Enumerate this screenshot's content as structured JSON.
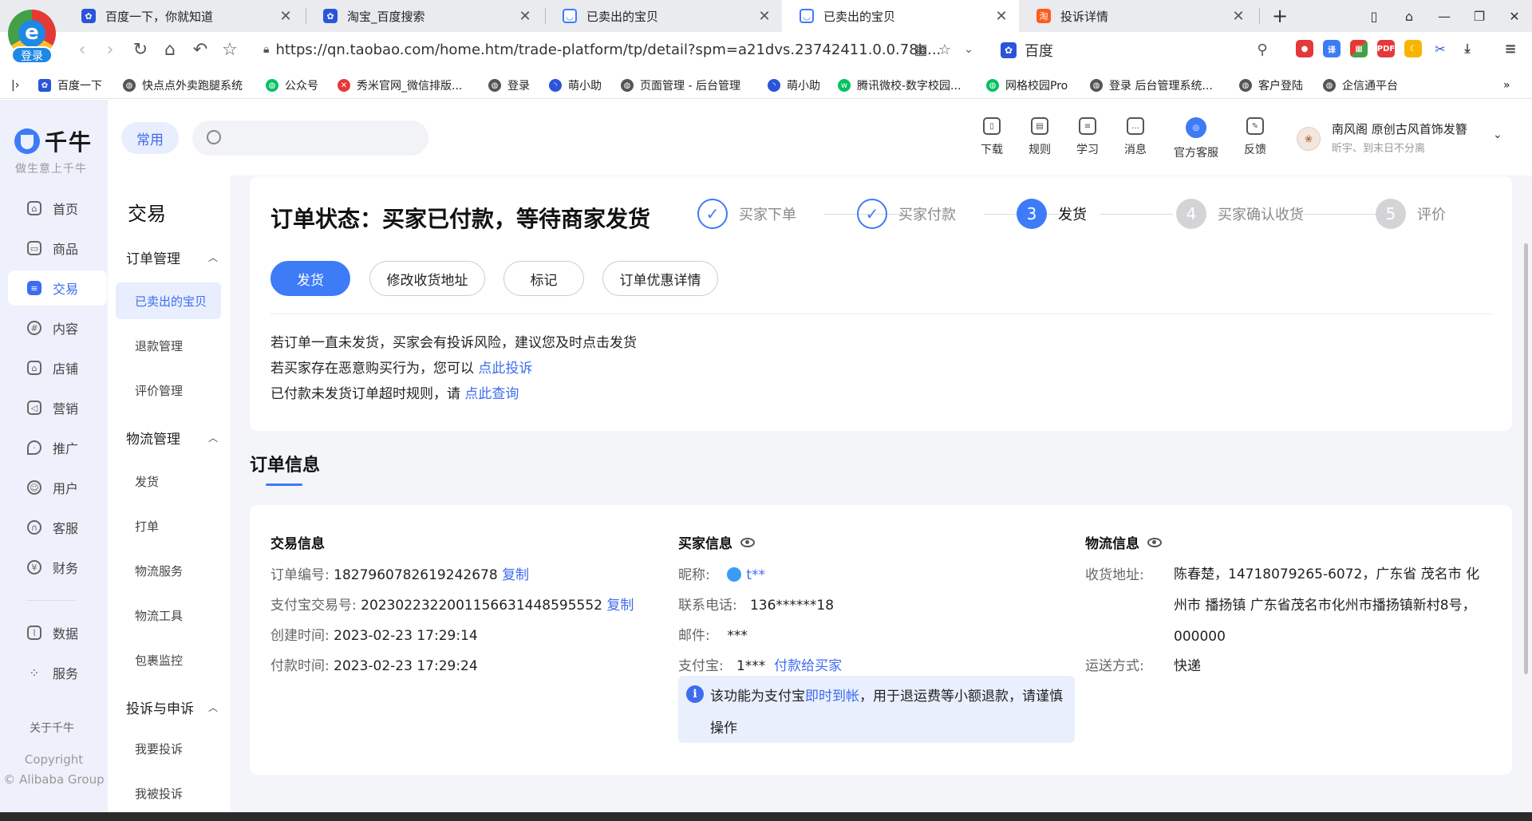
{
  "browser": {
    "logo_letter": "e",
    "logo_login": "登录",
    "tabs": [
      {
        "title": "百度一下，你就知道",
        "favicon": "baidu-icon",
        "active": false
      },
      {
        "title": "淘宝_百度搜索",
        "favicon": "baidu-icon",
        "active": false
      },
      {
        "title": "已卖出的宝贝",
        "favicon": "qianniu-icon",
        "active": false
      },
      {
        "title": "已卖出的宝贝",
        "favicon": "qianniu-icon",
        "active": true
      },
      {
        "title": "投诉详情",
        "favicon": "taobao-icon",
        "active": false
      }
    ],
    "new_tab": "+",
    "url": "https://qn.taobao.com/home.htm/trade-platform/tp/detail?spm=a21dvs.23742411.0.0.78b...",
    "search_engine": "百度",
    "bookmarks": [
      "百度一下",
      "快点点外卖跑腿系统",
      "公众号",
      "秀米官网_微信排版...",
      "登录",
      "萌小助",
      "页面管理 - 后台管理",
      "萌小助",
      "腾讯微校-数字校园...",
      "网格校园Pro",
      "登录 后台管理系统...",
      "客户登陆",
      "企信通平台"
    ],
    "more": "»",
    "colors": {
      "accent": "#3d7bf7"
    }
  },
  "app": {
    "brand_name": "千牛",
    "brand_slogan": "做生意上千牛",
    "nav": [
      {
        "label": "首页",
        "icon": "home-icon"
      },
      {
        "label": "商品",
        "icon": "goods-icon"
      },
      {
        "label": "交易",
        "icon": "trade-icon",
        "active": true
      },
      {
        "label": "内容",
        "icon": "content-icon"
      },
      {
        "label": "店铺",
        "icon": "shop-icon"
      },
      {
        "label": "营销",
        "icon": "megaphone-icon"
      },
      {
        "label": "推广",
        "icon": "location-icon"
      },
      {
        "label": "用户",
        "icon": "user-icon"
      },
      {
        "label": "客服",
        "icon": "headset-icon"
      },
      {
        "label": "财务",
        "icon": "yen-icon"
      },
      {
        "label": "数据",
        "icon": "chart-icon"
      },
      {
        "label": "服务",
        "icon": "grid-icon"
      }
    ],
    "about": "关于千牛",
    "copyright_1": "Copyright",
    "copyright_2": "© Alibaba Group",
    "common_chip": "常用",
    "tools": [
      {
        "label": "下载",
        "icon": "download-icon"
      },
      {
        "label": "规则",
        "icon": "rules-icon"
      },
      {
        "label": "学习",
        "icon": "learn-icon"
      },
      {
        "label": "消息",
        "icon": "message-icon"
      },
      {
        "label": "官方客服",
        "icon": "support-icon"
      },
      {
        "label": "反馈",
        "icon": "feedback-icon"
      }
    ],
    "shop_name": "南风阁 原创古风首饰发簪",
    "shop_status": "昕宇、到末日不分离"
  },
  "subnav": {
    "title": "交易",
    "group_order": "订单管理",
    "order_items": [
      "已卖出的宝贝",
      "退款管理",
      "评价管理"
    ],
    "group_logistics": "物流管理",
    "logistics_items": [
      "发货",
      "打单",
      "物流服务",
      "物流工具",
      "包裹监控"
    ],
    "group_complaints": "投诉与申诉",
    "complaint_items": [
      "我要投诉",
      "我被投诉"
    ]
  },
  "order_status": {
    "title": "订单状态：买家已付款，等待商家发货",
    "steps": [
      {
        "num": "✓",
        "label": "买家下单",
        "state": "done"
      },
      {
        "num": "✓",
        "label": "买家付款",
        "state": "done"
      },
      {
        "num": "3",
        "label": "发货",
        "state": "current"
      },
      {
        "num": "4",
        "label": "买家确认收货",
        "state": "todo"
      },
      {
        "num": "5",
        "label": "评价",
        "state": "todo"
      }
    ],
    "buttons": {
      "ship": "发货",
      "edit_address": "修改收货地址",
      "mark": "标记",
      "discount_detail": "订单优惠详情"
    },
    "hint_1": "若订单一直未发货，买家会有投诉风险，建议您及时点击发货",
    "hint_2_text": "若买家存在恶意购买行为，您可以",
    "hint_2_link": "点此投诉",
    "hint_3_text": "已付款未发货订单超时规则，请",
    "hint_3_link": "点此查询"
  },
  "order_info": {
    "section_title": "订单信息",
    "trade": {
      "title": "交易信息",
      "order_no_label": "订单编号:",
      "order_no": "1827960782619242678",
      "alipay_no_label": "支付宝交易号:",
      "alipay_no": "2023022322001156631448595552",
      "copy": "复制",
      "created_label": "创建时间:",
      "created": "2023-02-23 17:29:14",
      "paid_label": "付款时间:",
      "paid": "2023-02-23 17:29:24"
    },
    "buyer": {
      "title": "买家信息",
      "nick_label": "昵称:",
      "nick": "t**",
      "phone_label": "联系电话:",
      "phone": "136******18",
      "mail_label": "邮件:",
      "mail": "***",
      "alipay_label": "支付宝:",
      "alipay": "1***",
      "pay_link": "付款给买家",
      "notice_pre": "该功能为支付宝",
      "notice_link": "即时到帐",
      "notice_post": "，用于退运费等小额退款，请谨慎操作"
    },
    "logistics": {
      "title": "物流信息",
      "address_label": "收货地址:",
      "address": "陈春楚，14718079265-6072，广东省 茂名市 化州市 播扬镇 广东省茂名市化州市播扬镇新村8号，000000",
      "shipping_label": "运送方式:",
      "shipping": "快递"
    }
  }
}
